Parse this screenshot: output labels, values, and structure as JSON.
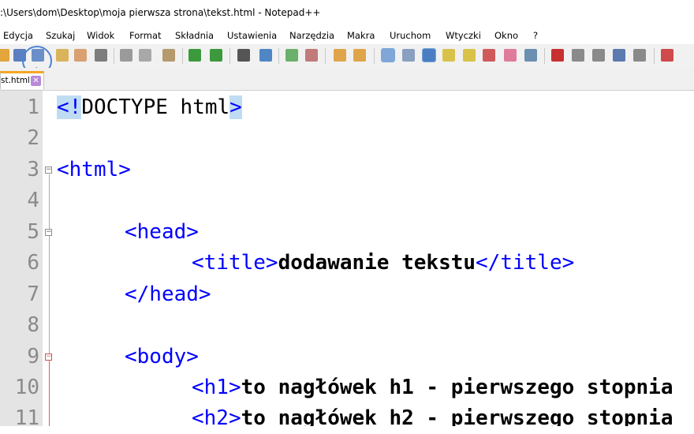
{
  "window": {
    "title": ":\\Users\\dom\\Desktop\\moja pierwsza strona\\tekst.html - Notepad++"
  },
  "menu": [
    "Edycja",
    "Szukaj",
    "Widok",
    "Format",
    "Składnia",
    "Ustawienia",
    "Narzędzia",
    "Makra",
    "Uruchom",
    "Wtyczki",
    "Okno",
    "?"
  ],
  "tab": {
    "label": "st.html",
    "close": "✕"
  },
  "line_numbers": [
    "1",
    "2",
    "3",
    "4",
    "5",
    "6",
    "7",
    "8",
    "9",
    "10",
    "11"
  ],
  "code": {
    "l1_open": "<!",
    "l1_doc": "DOCTYPE html",
    "l1_close": ">",
    "l3": "<html>",
    "l5": "<head>",
    "l6_open": "<title>",
    "l6_text": "dodawanie tekstu",
    "l6_close": "</title>",
    "l7": "</head>",
    "l9": "<body>",
    "l10_open": "<h1>",
    "l10_text": "to nagłówek h1 - pierwszego stopnia",
    "l11_open": "<h2>",
    "l11_text": "to nagłówek h2 - pierwszego stopnia"
  },
  "colors": {
    "tag": "#0000ff",
    "text": "#000000",
    "selection": "#c0dcf3",
    "gutter": "#e4e4e4",
    "tab_accent": "#f5a623"
  }
}
